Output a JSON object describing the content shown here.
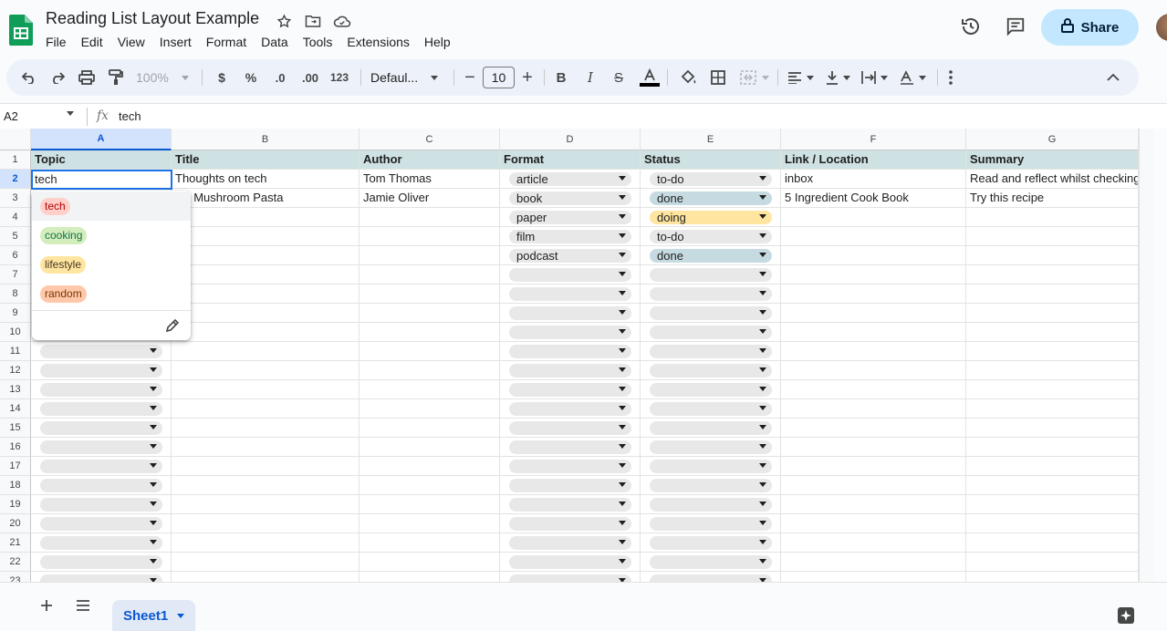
{
  "app": {
    "title": "Reading List Layout Example"
  },
  "menu": [
    "File",
    "Edit",
    "View",
    "Insert",
    "Format",
    "Data",
    "Tools",
    "Extensions",
    "Help"
  ],
  "share_label": "Share",
  "toolbar": {
    "zoom": "100%",
    "currency": "$",
    "percent": "%",
    "dec_decrease": ".0",
    "dec_increase": ".00",
    "number_format": "123",
    "font_name": "Defaul...",
    "font_size": "10"
  },
  "formula_bar": {
    "name_box": "A2",
    "fx": "fx",
    "content": "tech"
  },
  "columns": [
    "A",
    "B",
    "C",
    "D",
    "E",
    "F",
    "G"
  ],
  "rows": [
    "1",
    "2",
    "3",
    "4",
    "5",
    "6",
    "7",
    "8",
    "9",
    "10",
    "11",
    "12",
    "13",
    "14",
    "15",
    "16",
    "17",
    "18",
    "19",
    "20",
    "21",
    "22",
    "23"
  ],
  "header_row": {
    "A": "Topic",
    "B": "Title",
    "C": "Author",
    "D": "Format",
    "E": "Status",
    "F": "Link / Location",
    "G": "Summary"
  },
  "data_rows": [
    {
      "A": "tech",
      "B": "Thoughts on tech",
      "C": "Tom Thomas",
      "D": "article",
      "E": "to-do",
      "F": "inbox",
      "G": "Read and reflect whilst checking"
    },
    {
      "A": "",
      "B": "rlic Mushroom Pasta",
      "C": "Jamie Oliver",
      "D": "book",
      "E": "done",
      "F": "5 Ingredient Cook Book",
      "G": "Try this recipe"
    },
    {
      "A": "",
      "B": "",
      "C": "",
      "D": "paper",
      "E": "doing",
      "F": "",
      "G": ""
    },
    {
      "A": "",
      "B": "",
      "C": "",
      "D": "film",
      "E": "to-do",
      "F": "",
      "G": ""
    },
    {
      "A": "",
      "B": "",
      "C": "",
      "D": "podcast",
      "E": "done",
      "F": "",
      "G": ""
    }
  ],
  "status_colors": {
    "to-do": "#e8e8e8",
    "done": "#c6dbe1",
    "doing": "#ffe5a0"
  },
  "dropdown": {
    "options": [
      {
        "label": "tech",
        "bg": "#ffcfc9",
        "fg": "#b10202"
      },
      {
        "label": "cooking",
        "bg": "#d4edbc",
        "fg": "#11734b"
      },
      {
        "label": "lifestyle",
        "bg": "#ffe5a0",
        "fg": "#473821"
      },
      {
        "label": "random",
        "bg": "#ffc8aa",
        "fg": "#753800"
      }
    ],
    "edit_icon": "pencil-icon"
  },
  "sheets": [
    {
      "name": "Sheet1",
      "active": true
    }
  ],
  "colors": {
    "accent": "#0b57d0",
    "share_bg": "#c2e7ff",
    "header_row_bg": "#cfe2e3"
  }
}
